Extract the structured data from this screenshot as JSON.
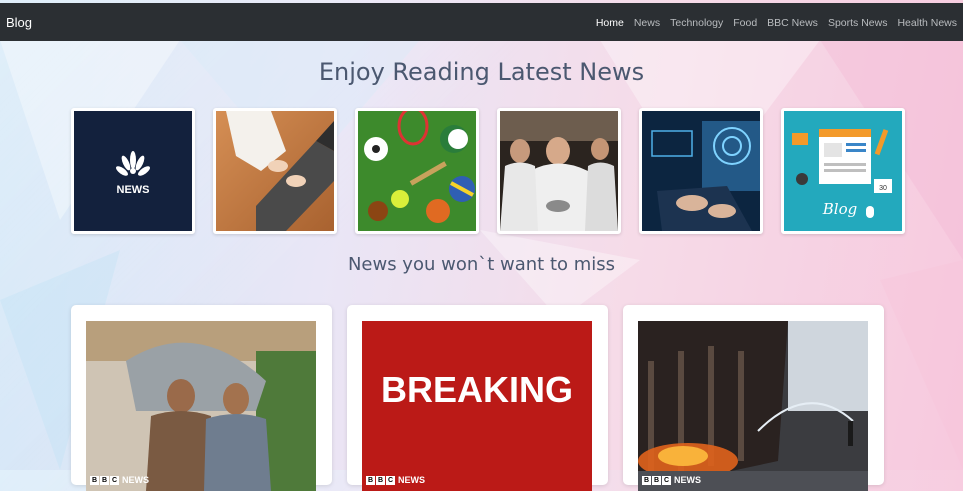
{
  "navbar": {
    "brand": "Blog",
    "links": [
      "Home",
      "News",
      "Technology",
      "Food",
      "BBC News",
      "Sports News",
      "Health News"
    ],
    "active": "Home"
  },
  "hero": {
    "title": "Enjoy Reading Latest News"
  },
  "categories": [
    {
      "name": "nbc-news"
    },
    {
      "name": "laptop-typing"
    },
    {
      "name": "sports"
    },
    {
      "name": "food-chef"
    },
    {
      "name": "technology"
    },
    {
      "name": "blog"
    }
  ],
  "thumb_labels": {
    "nbc": "NEWS",
    "blog": "Blog",
    "calendar": "30"
  },
  "section": {
    "title": "News you won`t want to miss"
  },
  "cards": [
    {
      "name": "rain-women",
      "badge_letters": [
        "B",
        "B",
        "C"
      ],
      "badge_text": "NEWS"
    },
    {
      "name": "breaking",
      "headline": "BREAKING",
      "badge_letters": [
        "B",
        "B",
        "C"
      ],
      "badge_text": "NEWS"
    },
    {
      "name": "fire",
      "badge_letters": [
        "B",
        "B",
        "C"
      ],
      "badge_text": "NEWS"
    }
  ],
  "colors": {
    "navbar": "#2b2f33",
    "breaking_red": "#bb1a17",
    "nbc_navy": "#13213d",
    "blog_teal": "#23a9bd"
  }
}
